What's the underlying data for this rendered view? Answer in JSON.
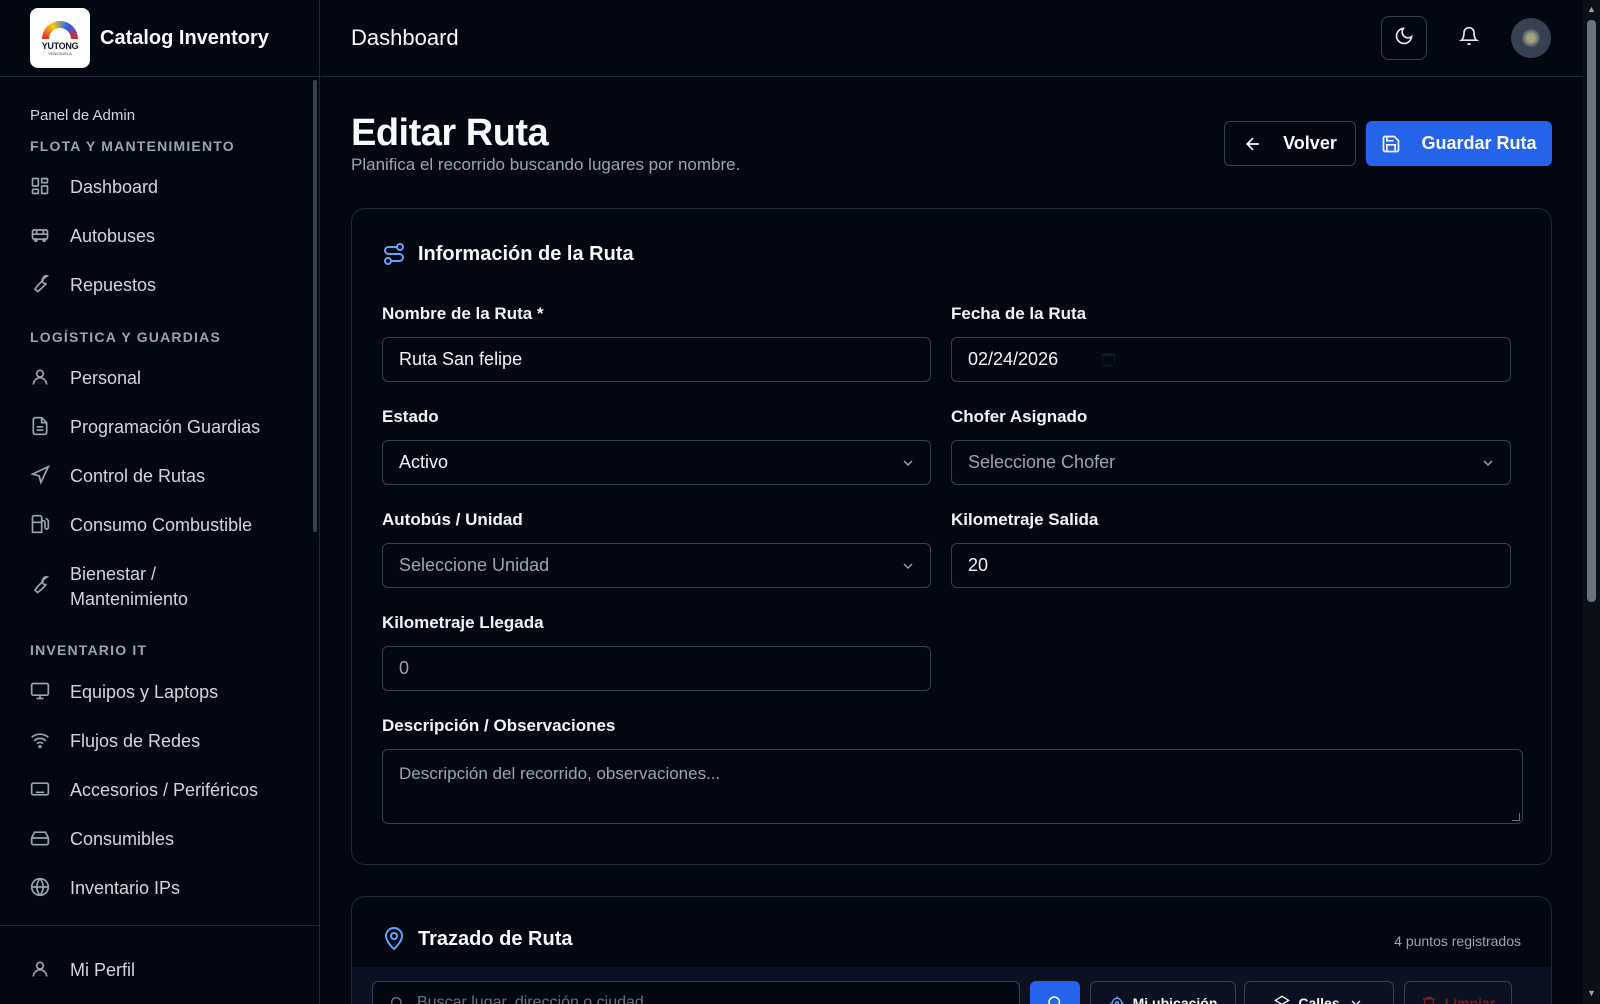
{
  "app": {
    "name": "Catalog Inventory",
    "logo_text": "YUTONG",
    "logo_sub": "VENEZUELA"
  },
  "sidebar": {
    "panel_label": "Panel de Admin",
    "sections": [
      {
        "label": "FLOTA Y MANTENIMIENTO",
        "items": [
          {
            "label": "Dashboard",
            "icon": "dashboard-icon"
          },
          {
            "label": "Autobuses",
            "icon": "bus-icon"
          },
          {
            "label": "Repuestos",
            "icon": "wrench-icon"
          }
        ]
      },
      {
        "label": "LOGÍSTICA Y GUARDIAS",
        "items": [
          {
            "label": "Personal",
            "icon": "user-icon"
          },
          {
            "label": "Programación Guardias",
            "icon": "document-icon"
          },
          {
            "label": "Control de Rutas",
            "icon": "navigation-icon"
          },
          {
            "label": "Consumo Combustible",
            "icon": "fuel-icon"
          },
          {
            "label": "Bienestar / Mantenimiento",
            "icon": "wrench-icon"
          }
        ]
      },
      {
        "label": "INVENTARIO IT",
        "items": [
          {
            "label": "Equipos y Laptops",
            "icon": "monitor-icon"
          },
          {
            "label": "Flujos de Redes",
            "icon": "wifi-icon"
          },
          {
            "label": "Accesorios / Periféricos",
            "icon": "keyboard-icon"
          },
          {
            "label": "Consumibles",
            "icon": "drive-icon"
          },
          {
            "label": "Inventario IPs",
            "icon": "globe-icon"
          }
        ]
      }
    ],
    "profile": {
      "label": "Mi Perfil",
      "icon": "user-icon"
    }
  },
  "header": {
    "title": "Dashboard"
  },
  "page": {
    "title": "Editar Ruta",
    "subtitle": "Planifica el recorrido buscando lugares por nombre.",
    "back_label": "Volver",
    "save_label": "Guardar Ruta"
  },
  "route_info": {
    "title": "Información de la Ruta",
    "name": {
      "label": "Nombre de la Ruta *",
      "value": "Ruta San felipe"
    },
    "date": {
      "label": "Fecha de la Ruta",
      "value": "02/24/2026"
    },
    "status": {
      "label": "Estado",
      "value": "Activo"
    },
    "driver": {
      "label": "Chofer Asignado",
      "placeholder": "Seleccione Chofer"
    },
    "bus": {
      "label": "Autobús / Unidad",
      "placeholder": "Seleccione Unidad"
    },
    "km_out": {
      "label": "Kilometraje Salida",
      "value": "20"
    },
    "km_in": {
      "label": "Kilometraje Llegada",
      "value": "0"
    },
    "description": {
      "label": "Descripción / Observaciones",
      "placeholder": "Descripción del recorrido, observaciones..."
    }
  },
  "route_map": {
    "title": "Trazado de Ruta",
    "points": "4 puntos registrados",
    "search_placeholder": "Buscar lugar, dirección o ciudad",
    "my_location": "Mi ubicación",
    "layer": "Calles",
    "clear": "Limpiar"
  },
  "colors": {
    "accent": "#2563eb",
    "background": "#030712",
    "border": "#1f2937"
  }
}
